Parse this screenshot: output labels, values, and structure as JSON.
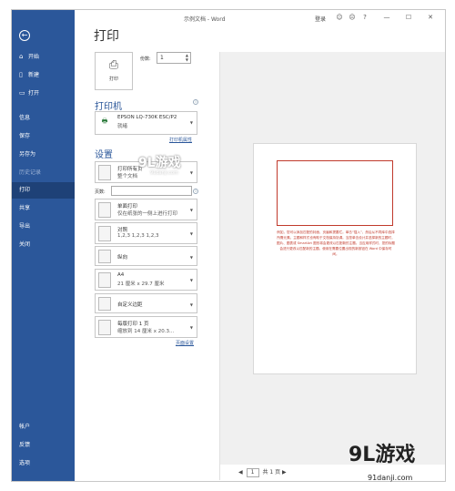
{
  "window": {
    "title": "示例文档 - Word",
    "login": "登录"
  },
  "titlebar_icons": [
    "smile-icon",
    "sad-icon",
    "help-icon",
    "minimize-icon",
    "maximize-icon",
    "close-icon"
  ],
  "titlebar_glyphs": {
    "smile": "☺",
    "sad": "☹",
    "help": "?",
    "minimize": "—",
    "maximize": "☐",
    "close": "✕"
  },
  "sidebar": {
    "back_glyph": "←",
    "items": [
      {
        "label": "开始",
        "icon": "⌂"
      },
      {
        "label": "新建",
        "icon": "▯"
      },
      {
        "label": "打开",
        "icon": "▭"
      },
      {
        "label": "信息",
        "icon": ""
      },
      {
        "label": "保存",
        "icon": ""
      },
      {
        "label": "另存为",
        "icon": ""
      },
      {
        "label": "历史记录",
        "icon": ""
      },
      {
        "label": "打印",
        "icon": ""
      },
      {
        "label": "共享",
        "icon": ""
      },
      {
        "label": "导出",
        "icon": ""
      },
      {
        "label": "关闭",
        "icon": ""
      }
    ],
    "bottom": [
      {
        "label": "帐户"
      },
      {
        "label": "反馈"
      },
      {
        "label": "选项"
      }
    ]
  },
  "print": {
    "title": "打印",
    "button_label": "打印",
    "copies_label": "份数:",
    "copies_value": "1"
  },
  "printer": {
    "heading": "打印机",
    "name": "EPSON LQ-730K ESC/P2",
    "status": "就绪",
    "properties_link": "打印机属性"
  },
  "settings": {
    "heading": "设置",
    "what": {
      "main": "打印所有页",
      "sub": "整个文档"
    },
    "pages_label": "页数:",
    "sides": {
      "main": "单面打印",
      "sub": "仅在纸张的一侧上进行打印"
    },
    "collate": {
      "main": "对照",
      "sub": "1,2,3    1,2,3    1,2,3"
    },
    "orientation": {
      "main": "纵向"
    },
    "paper": {
      "main": "A4",
      "sub": "21 厘米 x 29.7 厘米"
    },
    "margins": {
      "main": "自定义边距"
    },
    "per_sheet": {
      "main": "每版打印 1 页",
      "sub": "缩放到 14 厘米 x 20.3..."
    },
    "page_setup_link": "页面设置"
  },
  "preview": {
    "text": "例如，您可以添加匹配的封面、页眉和提要栏。单击“插入”，然后从不同库中选择所需元素。主题和样式也有助于文档保持协调。当您单击设计并选择新的主题时，图片、图表或 SmartArt 图形将会更改以匹配新的主题。当应用样式时，您的标题会进行更改以匹配新的主题。使用在需要位置出现的新按钮在 Word 中保存时间。"
  },
  "pager": {
    "prev": "◀",
    "page": "1",
    "total": "共 1 页",
    "next": "▶"
  },
  "watermark": {
    "brand": "9L游戏",
    "site": "91danji.com"
  },
  "colors": {
    "sidebar": "#2b579a",
    "active": "#1e4177",
    "accent": "#2b579a",
    "preview_red": "#c0392b"
  }
}
